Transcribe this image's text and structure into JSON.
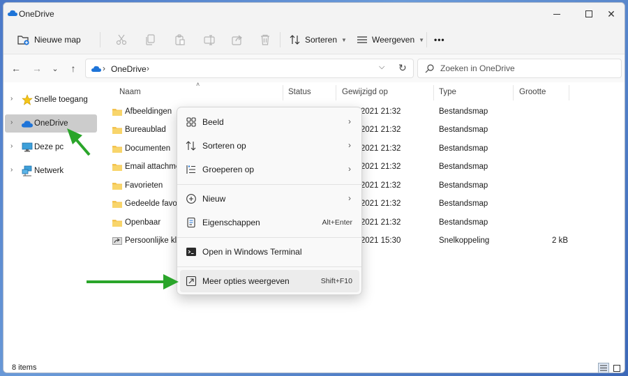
{
  "window": {
    "title": "OneDrive",
    "controls": {
      "minimize": "—",
      "maximize": "☐",
      "close": "✕"
    }
  },
  "toolbar": {
    "new_folder_label": "Nieuwe map",
    "sort_label": "Sorteren",
    "view_label": "Weergeven",
    "more_label": "•••"
  },
  "navigation": {
    "back": "←",
    "forward": "→",
    "recent": "⌄",
    "up": "↑",
    "address_location": "OneDrive",
    "search_placeholder": "Zoeken in OneDrive"
  },
  "sidebar": {
    "items": [
      {
        "label": "Snelle toegang",
        "icon": "star-icon"
      },
      {
        "label": "OneDrive",
        "icon": "cloud-icon",
        "selected": true
      },
      {
        "label": "Deze pc",
        "icon": "monitor-icon"
      },
      {
        "label": "Netwerk",
        "icon": "network-icon"
      }
    ]
  },
  "columns": [
    "Naam",
    "Status",
    "Gewijzigd op",
    "Type",
    "Grootte"
  ],
  "files": [
    {
      "name": "Afbeeldingen",
      "modified": "10-7-2021 21:32",
      "type": "Bestandsmap",
      "size": ""
    },
    {
      "name": "Bureaublad",
      "modified": "10-7-2021 21:32",
      "type": "Bestandsmap",
      "size": ""
    },
    {
      "name": "Documenten",
      "modified": "10-7-2021 21:32",
      "type": "Bestandsmap",
      "size": ""
    },
    {
      "name": "Email attachments",
      "modified": "10-7-2021 21:32",
      "type": "Bestandsmap",
      "size": ""
    },
    {
      "name": "Favorieten",
      "modified": "10-7-2021 21:32",
      "type": "Bestandsmap",
      "size": ""
    },
    {
      "name": "Gedeelde favorieten",
      "modified": "10-7-2021 21:32",
      "type": "Bestandsmap",
      "size": ""
    },
    {
      "name": "Openbaar",
      "modified": "10-7-2021 21:32",
      "type": "Bestandsmap",
      "size": ""
    },
    {
      "name": "Persoonlijke kluis",
      "modified": "10-7-2021 15:30",
      "type": "Snelkoppeling",
      "size": "2 kB"
    }
  ],
  "context_menu": {
    "items": [
      {
        "label": "Beeld",
        "icon": "grid-icon",
        "submenu": "›"
      },
      {
        "label": "Sorteren op",
        "icon": "sort-icon",
        "submenu": "›"
      },
      {
        "label": "Groeperen op",
        "icon": "group-icon",
        "submenu": "›"
      },
      {
        "label": "Nieuw",
        "icon": "plus-circle-icon",
        "submenu": "›"
      },
      {
        "label": "Eigenschappen",
        "icon": "properties-icon",
        "shortcut": "Alt+Enter"
      },
      {
        "label": "Open in Windows Terminal",
        "icon": "terminal-icon"
      },
      {
        "label": "Meer opties weergeven",
        "icon": "expand-icon",
        "shortcut": "Shift+F10"
      }
    ]
  },
  "status": {
    "item_count": "8 items"
  },
  "colors": {
    "accent_green": "#2aa52a",
    "folder_yellow": "#f3c24f",
    "onedrive_blue": "#1e74d8",
    "selected_bg": "#cccccc"
  }
}
